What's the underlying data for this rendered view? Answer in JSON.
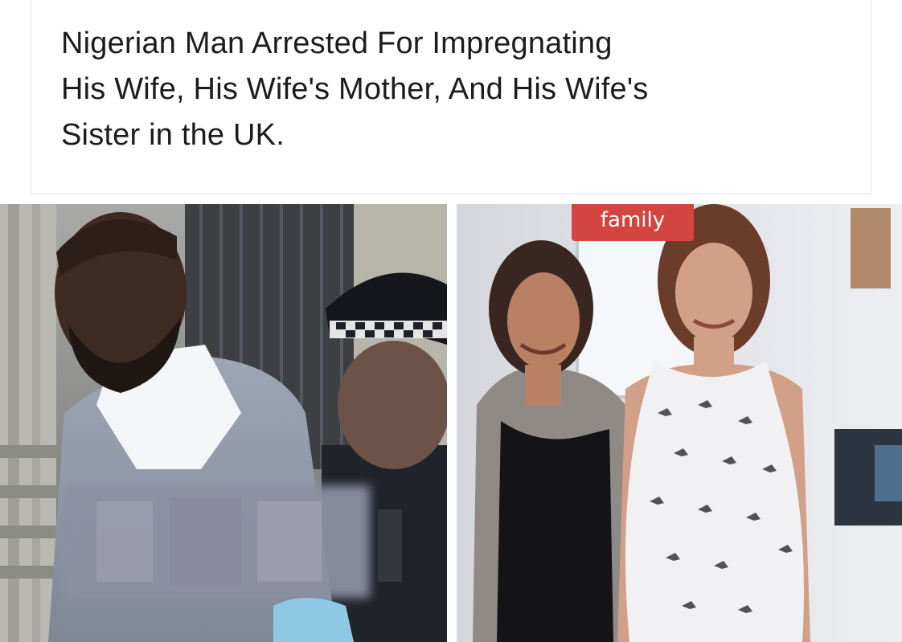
{
  "post": {
    "headline_lines": [
      "Nigerian Man Arrested For Impregnating",
      "His Wife, His Wife's Mother, And His Wife's",
      "Sister in the UK."
    ]
  },
  "images": {
    "left": {
      "semantic": "photo-man-escorted-by-police-officer"
    },
    "right": {
      "semantic": "photo-two-women-standing-indoors",
      "badge_label": "family",
      "badge_color": "#d5453f"
    }
  },
  "colors": {
    "page_background": "#ffffff",
    "headline_text": "#1c1c1c",
    "card_border": "#e3e3e3"
  }
}
